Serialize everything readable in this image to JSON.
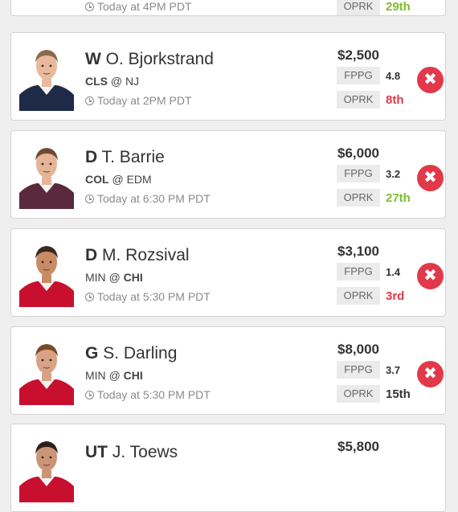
{
  "colors": {
    "good_rank": "#7cbf2e",
    "bad_rank": "#e2394a",
    "remove_button": "#e2394a",
    "stat_label_bg": "#ebebeb"
  },
  "top_partial": {
    "time": "Today at 4PM PDT",
    "oprk_label": "OPRK",
    "oprk_value": "29th",
    "oprk_tone": "good"
  },
  "players": [
    {
      "position": "W",
      "name": "O. Bjorkstrand",
      "team": "CLS",
      "at": "@",
      "opponent": "NJ",
      "bold": "team",
      "time": "Today at 2PM PDT",
      "salary": "$2,500",
      "fppg_label": "FPPG",
      "fppg": "4.8",
      "oprk_label": "OPRK",
      "oprk": "8th",
      "oprk_tone": "bad",
      "jersey": "#1f2a48",
      "skin": "#e8b99c",
      "hair": "#8a6a4a"
    },
    {
      "position": "D",
      "name": "T. Barrie",
      "team": "COL",
      "at": "@",
      "opponent": "EDM",
      "bold": "team",
      "time": "Today at 6:30 PM PDT",
      "salary": "$6,000",
      "fppg_label": "FPPG",
      "fppg": "3.2",
      "oprk_label": "OPRK",
      "oprk": "27th",
      "oprk_tone": "good",
      "jersey": "#5a2a3c",
      "skin": "#e6b497",
      "hair": "#6e4c32"
    },
    {
      "position": "D",
      "name": "M. Rozsival",
      "team": "MIN",
      "at": "@",
      "opponent": "CHI",
      "bold": "opponent",
      "time": "Today at 5:30 PM PDT",
      "salary": "$3,100",
      "fppg_label": "FPPG",
      "fppg": "1.4",
      "oprk_label": "OPRK",
      "oprk": "3rd",
      "oprk_tone": "bad",
      "jersey": "#c8102e",
      "skin": "#c98a66",
      "hair": "#3a2a20"
    },
    {
      "position": "G",
      "name": "S. Darling",
      "team": "MIN",
      "at": "@",
      "opponent": "CHI",
      "bold": "opponent",
      "time": "Today at 5:30 PM PDT",
      "salary": "$8,000",
      "fppg_label": "FPPG",
      "fppg": "3.7",
      "oprk_label": "OPRK",
      "oprk": "15th",
      "oprk_tone": "neutral",
      "jersey": "#c8102e",
      "skin": "#d9a285",
      "hair": "#7a4a2a"
    },
    {
      "position": "UT",
      "name": "J. Toews",
      "salary": "$5,800",
      "jersey": "#c8102e",
      "skin": "#c99576",
      "hair": "#2e2018"
    }
  ]
}
